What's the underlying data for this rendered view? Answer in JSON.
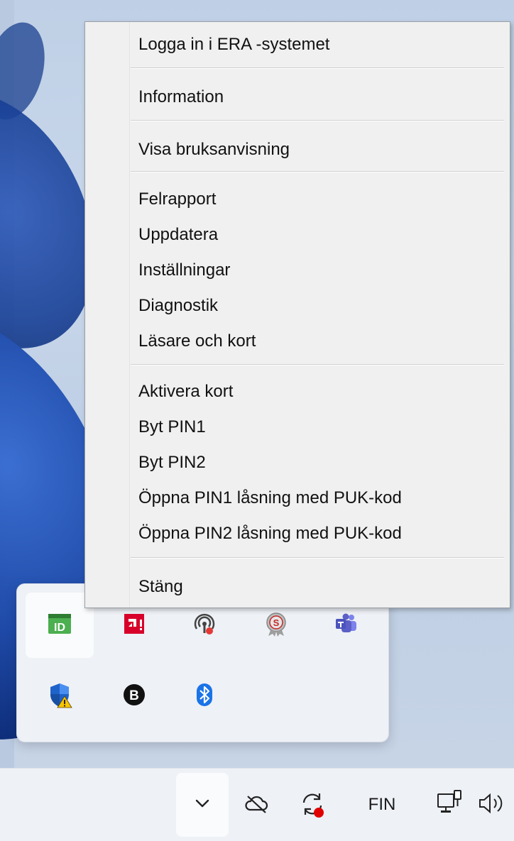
{
  "context_menu": {
    "items": [
      {
        "label": "Logga in i ERA -systemet"
      },
      {
        "label": "Information"
      },
      {
        "label": "Visa bruksanvisning"
      },
      {
        "label": "Felrapport"
      },
      {
        "label": "Uppdatera"
      },
      {
        "label": "Inställningar"
      },
      {
        "label": "Diagnostik"
      },
      {
        "label": "Läsare och kort"
      },
      {
        "label": "Aktivera kort"
      },
      {
        "label": "Byt PIN1"
      },
      {
        "label": "Byt PIN2"
      },
      {
        "label": "Öppna PIN1 låsning med PUK-kod"
      },
      {
        "label": "Öppna PIN2 låsning med PUK-kod"
      },
      {
        "label": "Stäng"
      }
    ]
  },
  "tray_overflow": {
    "icons": [
      {
        "name": "id-app-icon",
        "text": "ID",
        "color": "#4caf50"
      },
      {
        "name": "amd-icon",
        "color": "#d8002b"
      },
      {
        "name": "hotspot-icon"
      },
      {
        "name": "badge-s-icon",
        "text": "S"
      },
      {
        "name": "teams-icon",
        "color": "#5b5fc7"
      },
      {
        "name": "defender-warning-icon"
      },
      {
        "name": "b-app-icon",
        "text": "B"
      },
      {
        "name": "bluetooth-icon",
        "color": "#1a73e8"
      }
    ]
  },
  "taskbar": {
    "language": "FIN"
  }
}
